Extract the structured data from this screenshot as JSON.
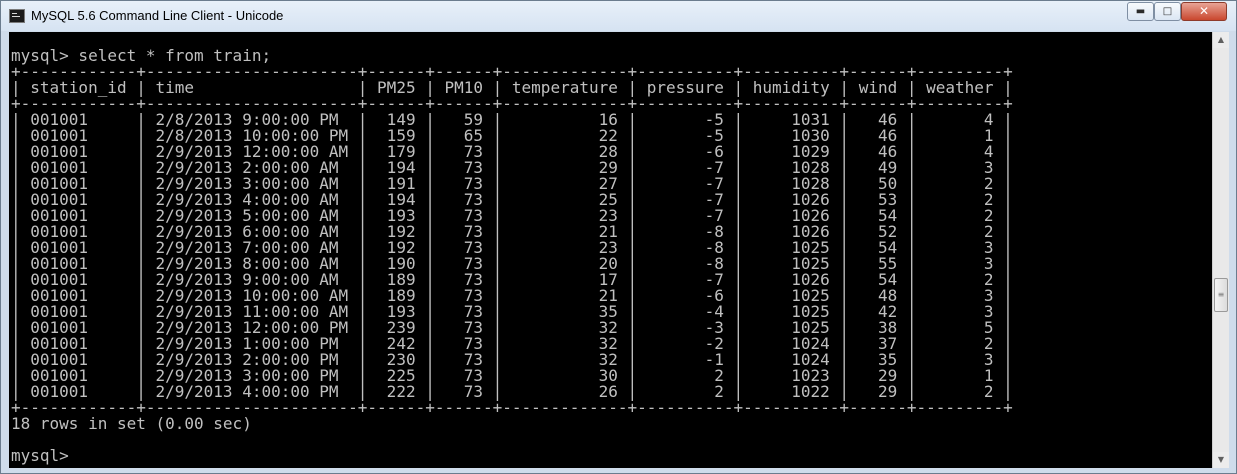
{
  "window": {
    "title": "MySQL 5.6 Command Line Client - Unicode",
    "controls": {
      "minimize": "▬",
      "maximize": "□",
      "close": "✕"
    }
  },
  "scrollbar": {
    "up": "▲",
    "down": "▼",
    "thumb": "≡"
  },
  "console": {
    "prompt": "mysql>",
    "command": "select * from train;",
    "columns": [
      "station_id",
      "time",
      "PM25",
      "PM10",
      "temperature",
      "pressure",
      "humidity",
      "wind",
      "weather"
    ],
    "rows": [
      [
        "001001",
        "2/8/2013 9:00:00 PM",
        "149",
        "59",
        "16",
        "-5",
        "1031",
        "46",
        "4"
      ],
      [
        "001001",
        "2/8/2013 10:00:00 PM",
        "159",
        "65",
        "22",
        "-5",
        "1030",
        "46",
        "1"
      ],
      [
        "001001",
        "2/9/2013 12:00:00 AM",
        "179",
        "73",
        "28",
        "-6",
        "1029",
        "46",
        "4"
      ],
      [
        "001001",
        "2/9/2013 2:00:00 AM",
        "194",
        "73",
        "29",
        "-7",
        "1028",
        "49",
        "3"
      ],
      [
        "001001",
        "2/9/2013 3:00:00 AM",
        "191",
        "73",
        "27",
        "-7",
        "1028",
        "50",
        "2"
      ],
      [
        "001001",
        "2/9/2013 4:00:00 AM",
        "194",
        "73",
        "25",
        "-7",
        "1026",
        "53",
        "2"
      ],
      [
        "001001",
        "2/9/2013 5:00:00 AM",
        "193",
        "73",
        "23",
        "-7",
        "1026",
        "54",
        "2"
      ],
      [
        "001001",
        "2/9/2013 6:00:00 AM",
        "192",
        "73",
        "21",
        "-8",
        "1026",
        "52",
        "2"
      ],
      [
        "001001",
        "2/9/2013 7:00:00 AM",
        "192",
        "73",
        "23",
        "-8",
        "1025",
        "54",
        "3"
      ],
      [
        "001001",
        "2/9/2013 8:00:00 AM",
        "190",
        "73",
        "20",
        "-8",
        "1025",
        "55",
        "3"
      ],
      [
        "001001",
        "2/9/2013 9:00:00 AM",
        "189",
        "73",
        "17",
        "-7",
        "1026",
        "54",
        "2"
      ],
      [
        "001001",
        "2/9/2013 10:00:00 AM",
        "189",
        "73",
        "21",
        "-6",
        "1025",
        "48",
        "3"
      ],
      [
        "001001",
        "2/9/2013 11:00:00 AM",
        "193",
        "73",
        "35",
        "-4",
        "1025",
        "42",
        "3"
      ],
      [
        "001001",
        "2/9/2013 12:00:00 PM",
        "239",
        "73",
        "32",
        "-3",
        "1025",
        "38",
        "5"
      ],
      [
        "001001",
        "2/9/2013 1:00:00 PM",
        "242",
        "73",
        "32",
        "-2",
        "1024",
        "37",
        "2"
      ],
      [
        "001001",
        "2/9/2013 2:00:00 PM",
        "230",
        "73",
        "32",
        "-1",
        "1024",
        "35",
        "3"
      ],
      [
        "001001",
        "2/9/2013 3:00:00 PM",
        "225",
        "73",
        "30",
        "2",
        "1023",
        "29",
        "1"
      ],
      [
        "001001",
        "2/9/2013 4:00:00 PM",
        "222",
        "73",
        "26",
        "2",
        "1022",
        "29",
        "2"
      ]
    ],
    "summary": "18 rows in set (0.00 sec)",
    "final_prompt": "mysql>"
  }
}
